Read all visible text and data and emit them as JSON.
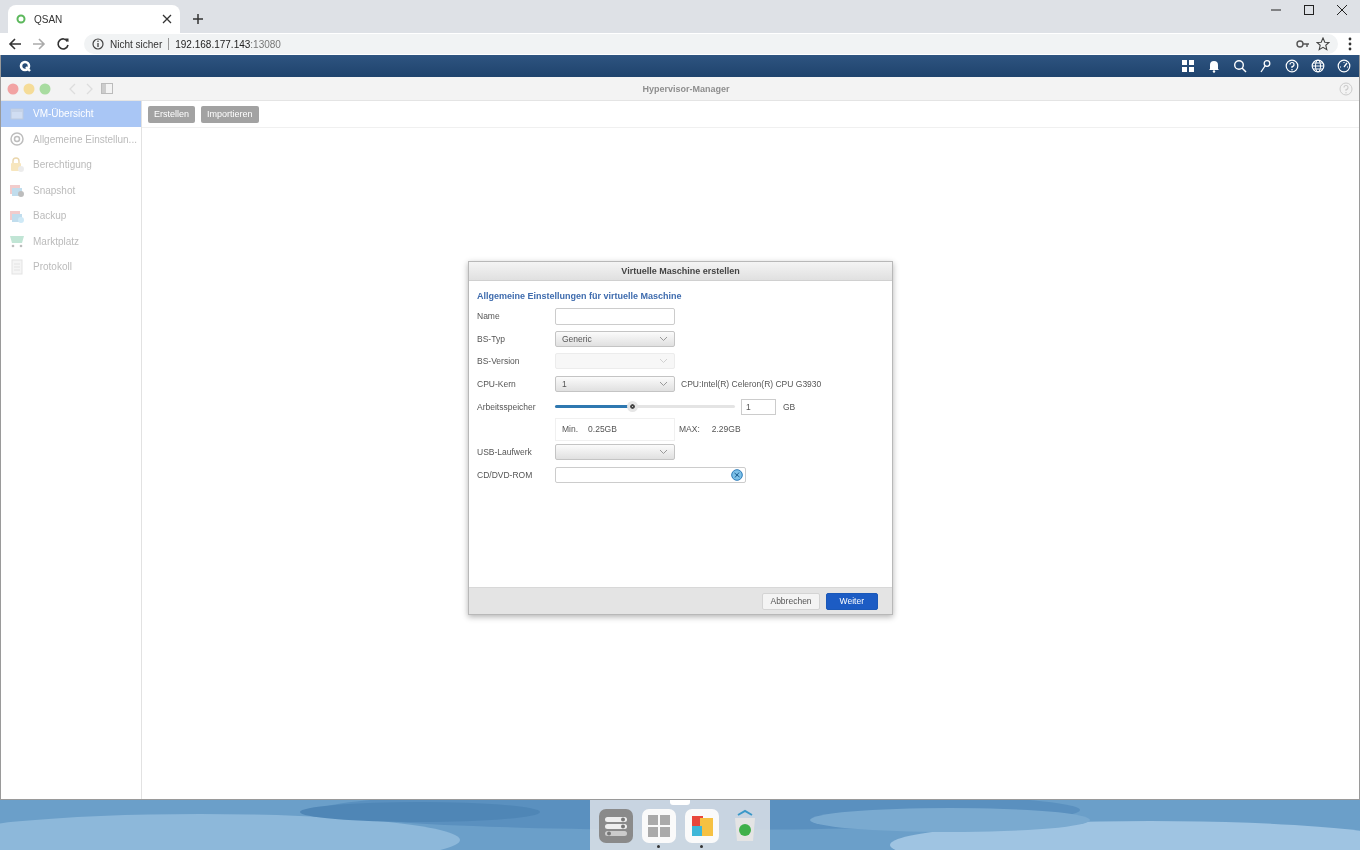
{
  "browser": {
    "tab": {
      "title": "QSAN",
      "selected": true
    },
    "address": {
      "security": "Nicht sicher",
      "host": "192.168.177.143",
      "port": ":13080"
    }
  },
  "window": {
    "title": "Hypervisor-Manager"
  },
  "sidebar": {
    "items": [
      {
        "label": "VM-Übersicht",
        "selected": true
      },
      {
        "label": "Allgemeine Einstellun...",
        "selected": false
      },
      {
        "label": "Berechtigung",
        "selected": false
      },
      {
        "label": "Snapshot",
        "selected": false
      },
      {
        "label": "Backup",
        "selected": false
      },
      {
        "label": "Marktplatz",
        "selected": false
      },
      {
        "label": "Protokoll",
        "selected": false
      }
    ]
  },
  "toolbar": {
    "buttons": [
      {
        "label": "Erstellen",
        "disabled": true
      },
      {
        "label": "Importieren",
        "disabled": true
      }
    ]
  },
  "dialog": {
    "title": "Virtuelle Maschine erstellen",
    "heading": "Allgemeine Einstellungen für virtuelle Maschine",
    "rows": [
      {
        "kind": "text",
        "label": "Name"
      },
      {
        "kind": "select",
        "label": "BS-Typ",
        "value": "Generic",
        "disabled": false
      },
      {
        "kind": "select",
        "label": "BS-Version",
        "disabled": true
      },
      {
        "kind": "select",
        "label": "CPU-Kern",
        "value": "1",
        "disabled": false,
        "note": "CPU:Intel(R) Celeron(R) CPU G3930"
      },
      {
        "kind": "slider",
        "label": "Arbeitsspeicher",
        "level": 0.43,
        "value": "1",
        "unit": "GB"
      },
      {
        "kind": "range",
        "min_label": "Min.",
        "min": "0.25GB",
        "max_label": "MAX:",
        "max": "2.29GB"
      },
      {
        "kind": "select",
        "label": "USB-Laufwerk",
        "disabled": false
      },
      {
        "kind": "file",
        "label": "CD/DVD-ROM"
      }
    ],
    "buttons": [
      {
        "label": "Abbrechen",
        "primary": false
      },
      {
        "label": "Weiter",
        "primary": true
      }
    ]
  },
  "dock": {
    "items": [
      {
        "running": false
      },
      {
        "running": true
      },
      {
        "running": true
      },
      {
        "running": false
      }
    ]
  }
}
